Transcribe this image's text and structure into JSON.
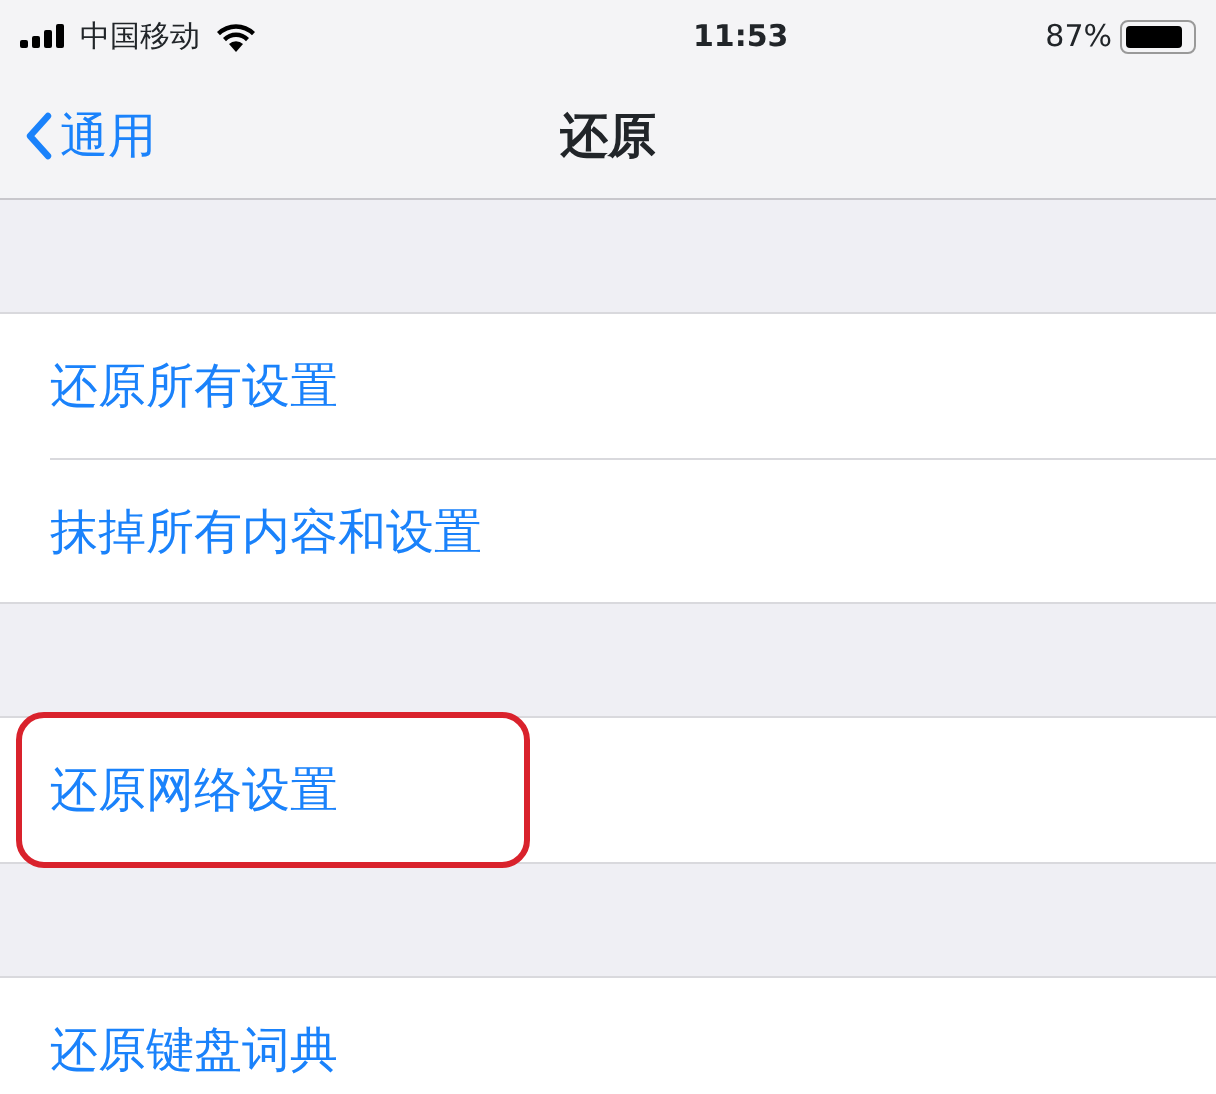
{
  "status_bar": {
    "carrier": "中国移动",
    "time": "11:53",
    "battery": "87%"
  },
  "nav": {
    "back": "通用",
    "title": "还原"
  },
  "groups": [
    {
      "items": [
        {
          "label": "还原所有设置",
          "highlighted": false
        },
        {
          "label": "抹掉所有内容和设置",
          "highlighted": false
        }
      ]
    },
    {
      "items": [
        {
          "label": "还原网络设置",
          "highlighted": true
        }
      ]
    },
    {
      "items": [
        {
          "label": "还原键盘词典",
          "highlighted": false
        }
      ]
    }
  ]
}
